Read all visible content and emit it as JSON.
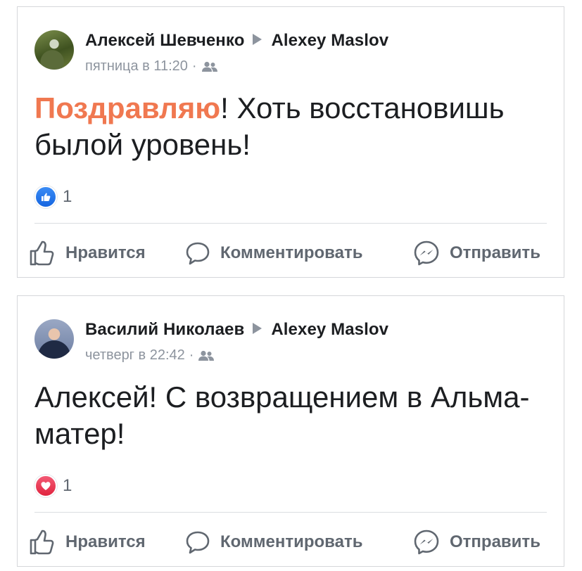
{
  "posts": [
    {
      "author": "Алексей Шевченко",
      "target": "Alexey Maslov",
      "time": "пятница в 11:20",
      "separator": "·",
      "audience_icon": "friends-icon",
      "message_highlight": "Поздравляю",
      "message_rest": "! Хоть восстановишь былой уровень!",
      "reaction_type": "like",
      "reaction_count": "1"
    },
    {
      "author": "Василий Николаев",
      "target": "Alexey Maslov",
      "time": "четверг в 22:42",
      "separator": "·",
      "audience_icon": "friends-icon",
      "message_highlight": "",
      "message_rest": "Алексей! С возвращением в Альма- матер!",
      "reaction_type": "love",
      "reaction_count": "1"
    }
  ],
  "actions": {
    "like": "Нравится",
    "comment": "Комментировать",
    "send": "Отправить"
  },
  "colors": {
    "highlight": "#f07850",
    "meta": "#8d949e",
    "action": "#606770",
    "like": "#1877f2",
    "love": "#e0243e"
  }
}
